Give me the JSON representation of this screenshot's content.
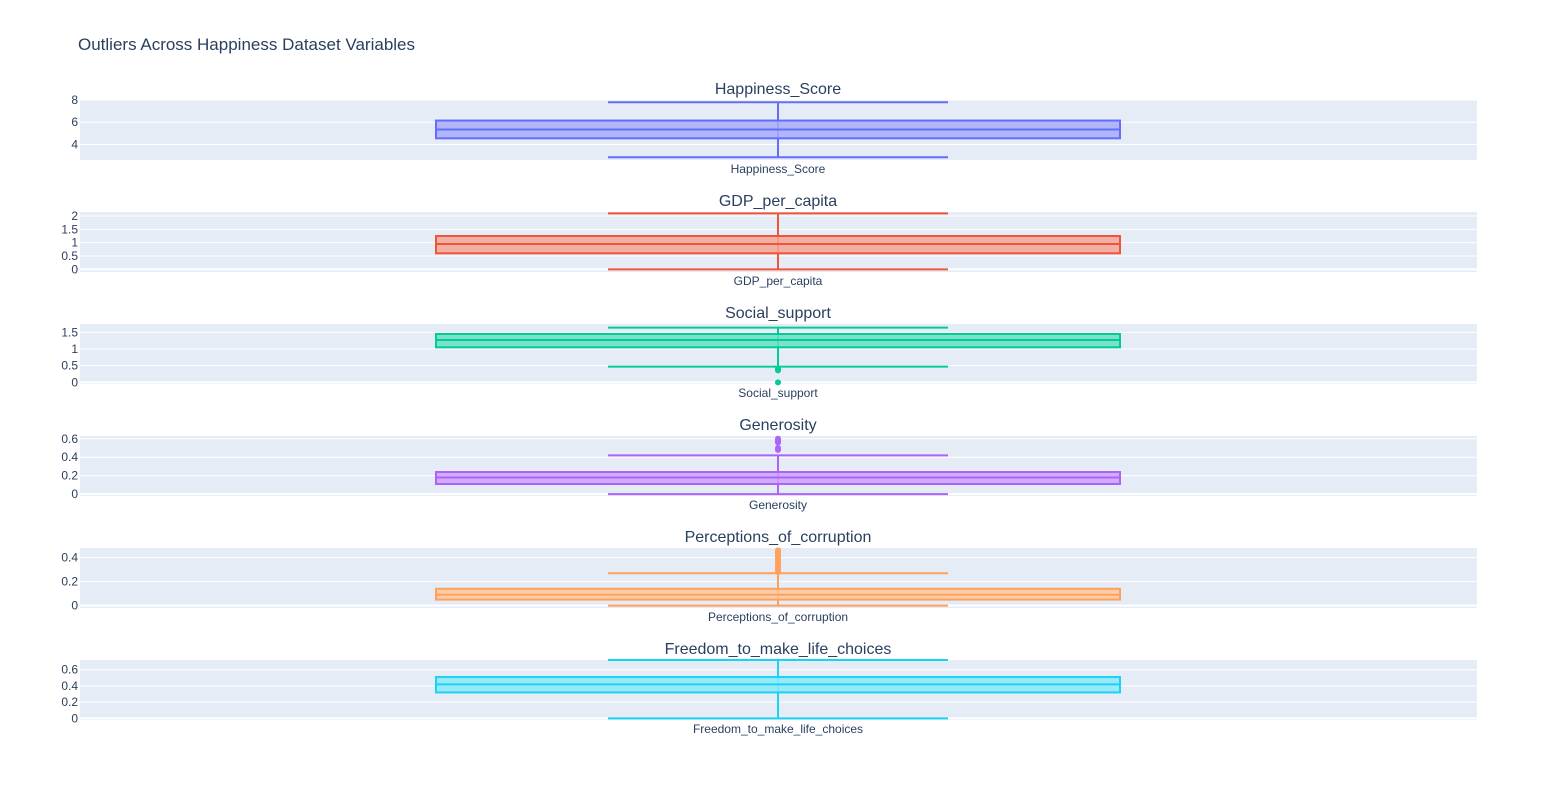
{
  "chart_data": {
    "type": "box",
    "title": "Outliers Across Happiness Dataset Variables",
    "panels": [
      {
        "name": "Happiness_Score",
        "subtitle": "Happiness_Score",
        "color": "#636efa",
        "fill": "#a7acfd",
        "yrange": [
          2.6,
          8.0
        ],
        "yticks": [
          {
            "v": 4,
            "label": "4"
          },
          {
            "v": 6,
            "label": "6"
          },
          {
            "v": 8,
            "label": "8"
          }
        ],
        "box": {
          "lowerfence": 2.85,
          "q1": 4.55,
          "median": 5.35,
          "q3": 6.15,
          "upperfence": 7.8
        },
        "outliers": []
      },
      {
        "name": "GDP_per_capita",
        "subtitle": "GDP_per_capita",
        "color": "#ef553b",
        "fill": "#f4a495",
        "yrange": [
          -0.1,
          2.15
        ],
        "yticks": [
          {
            "v": 0,
            "label": "0"
          },
          {
            "v": 0.5,
            "label": "0.5"
          },
          {
            "v": 1,
            "label": "1"
          },
          {
            "v": 1.5,
            "label": "1.5"
          },
          {
            "v": 2,
            "label": "2"
          }
        ],
        "box": {
          "lowerfence": 0.0,
          "q1": 0.6,
          "median": 0.95,
          "q3": 1.25,
          "upperfence": 2.1
        },
        "outliers": []
      },
      {
        "name": "Social_support",
        "subtitle": "Social_support",
        "color": "#00cc96",
        "fill": "#66e0c0",
        "yrange": [
          -0.05,
          1.75
        ],
        "yticks": [
          {
            "v": 0,
            "label": "0"
          },
          {
            "v": 0.5,
            "label": "0.5"
          },
          {
            "v": 1,
            "label": "1"
          },
          {
            "v": 1.5,
            "label": "1.5"
          }
        ],
        "box": {
          "lowerfence": 0.47,
          "q1": 1.05,
          "median": 1.27,
          "q3": 1.45,
          "upperfence": 1.64
        },
        "outliers": [
          0.0,
          0.36,
          0.38,
          0.4
        ]
      },
      {
        "name": "Generosity",
        "subtitle": "Generosity",
        "color": "#ab63fa",
        "fill": "#cda1fc",
        "yrange": [
          -0.02,
          0.63
        ],
        "yticks": [
          {
            "v": 0,
            "label": "0"
          },
          {
            "v": 0.2,
            "label": "0.2"
          },
          {
            "v": 0.4,
            "label": "0.4"
          },
          {
            "v": 0.6,
            "label": "0.6"
          }
        ],
        "box": {
          "lowerfence": 0.0,
          "q1": 0.11,
          "median": 0.18,
          "q3": 0.24,
          "upperfence": 0.42
        },
        "outliers": [
          0.48,
          0.5,
          0.56,
          0.58,
          0.6
        ]
      },
      {
        "name": "Perceptions_of_corruption",
        "subtitle": "Perceptions_of_corruption",
        "color": "#ffa15a",
        "fill": "#ffc79c",
        "yrange": [
          -0.02,
          0.48
        ],
        "yticks": [
          {
            "v": 0,
            "label": "0"
          },
          {
            "v": 0.2,
            "label": "0.2"
          },
          {
            "v": 0.4,
            "label": "0.4"
          }
        ],
        "box": {
          "lowerfence": 0.0,
          "q1": 0.05,
          "median": 0.09,
          "q3": 0.14,
          "upperfence": 0.27
        },
        "outliers": [
          0.28,
          0.3,
          0.31,
          0.32,
          0.33,
          0.34,
          0.35,
          0.36,
          0.38,
          0.4,
          0.41,
          0.42,
          0.44,
          0.45,
          0.46
        ]
      },
      {
        "name": "Freedom_to_make_life_choices",
        "subtitle": "Freedom_to_make_life_choices",
        "color": "#19d3f3",
        "fill": "#8ce9f9",
        "yrange": [
          -0.02,
          0.72
        ],
        "yticks": [
          {
            "v": 0,
            "label": "0"
          },
          {
            "v": 0.2,
            "label": "0.2"
          },
          {
            "v": 0.4,
            "label": "0.4"
          },
          {
            "v": 0.6,
            "label": "0.6"
          }
        ],
        "box": {
          "lowerfence": 0.0,
          "q1": 0.32,
          "median": 0.42,
          "q3": 0.51,
          "upperfence": 0.72
        },
        "outliers": []
      }
    ],
    "grid": true,
    "legend": false
  }
}
